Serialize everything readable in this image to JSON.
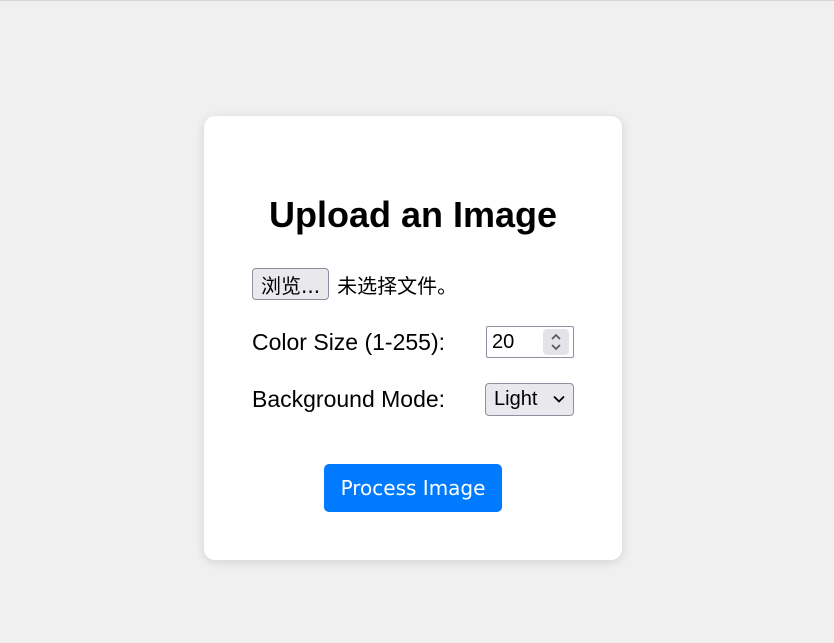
{
  "form": {
    "title": "Upload an Image",
    "file": {
      "browse_label": "浏览...",
      "status": "未选择文件。"
    },
    "color_size": {
      "label": "Color Size (1-255):",
      "value": "20"
    },
    "background_mode": {
      "label": "Background Mode:",
      "selected": "Light"
    },
    "submit_label": "Process Image"
  },
  "colors": {
    "page_background": "#f0f0f0",
    "card_background": "#ffffff",
    "accent": "#007bff"
  },
  "icons": {
    "spinner": "spinner-arrows-icon",
    "select": "chevron-down-icon"
  }
}
